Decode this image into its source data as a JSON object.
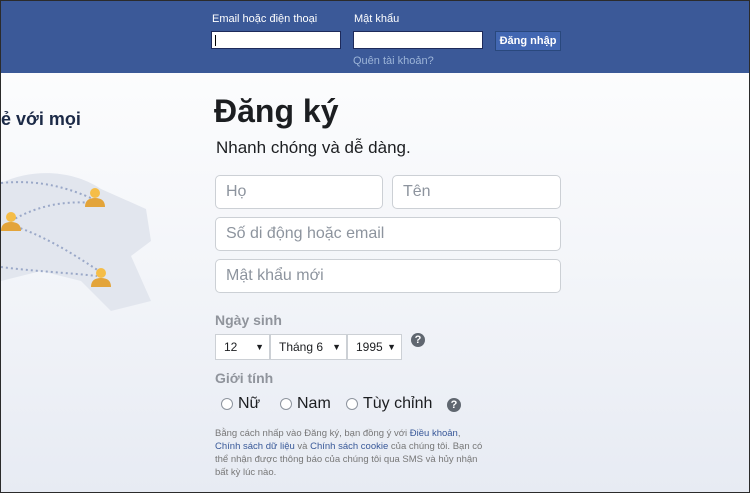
{
  "header": {
    "email_label": "Email hoặc điện thoại",
    "email_value": "",
    "password_label": "Mật khẩu",
    "password_value": "",
    "login_button": "Đăng nhập",
    "forgot_link": "Quên tài khoản?"
  },
  "left": {
    "tagline_partial": "ẻ với mọi"
  },
  "signup": {
    "title": "Đăng ký",
    "subtitle": "Nhanh chóng và dễ dàng.",
    "first_name_placeholder": "Họ",
    "last_name_placeholder": "Tên",
    "contact_placeholder": "Số di động hoặc email",
    "password_placeholder": "Mật khẩu mới",
    "birthday_label": "Ngày sinh",
    "birthday": {
      "day": "12",
      "month": "Tháng 6",
      "year": "1995"
    },
    "gender_label": "Giới tính",
    "gender_options": [
      "Nữ",
      "Nam",
      "Tùy chỉnh"
    ],
    "help_symbol": "?",
    "terms": {
      "part1": "Bằng cách nhấp vào Đăng ký, bạn đồng ý với ",
      "link_terms": "Điều khoản",
      "part2": ", ",
      "link_data": "Chính sách dữ liệu",
      "part3": " và ",
      "link_cookie": "Chính sách cookie",
      "part4": " của chúng tôi. Bạn có thể nhận được thông báo của chúng tôi qua SMS và hủy nhận bất kỳ lúc nào."
    }
  },
  "colors": {
    "header_bg": "#3b5998",
    "link": "#385898",
    "avatar": "#f5bd47"
  }
}
